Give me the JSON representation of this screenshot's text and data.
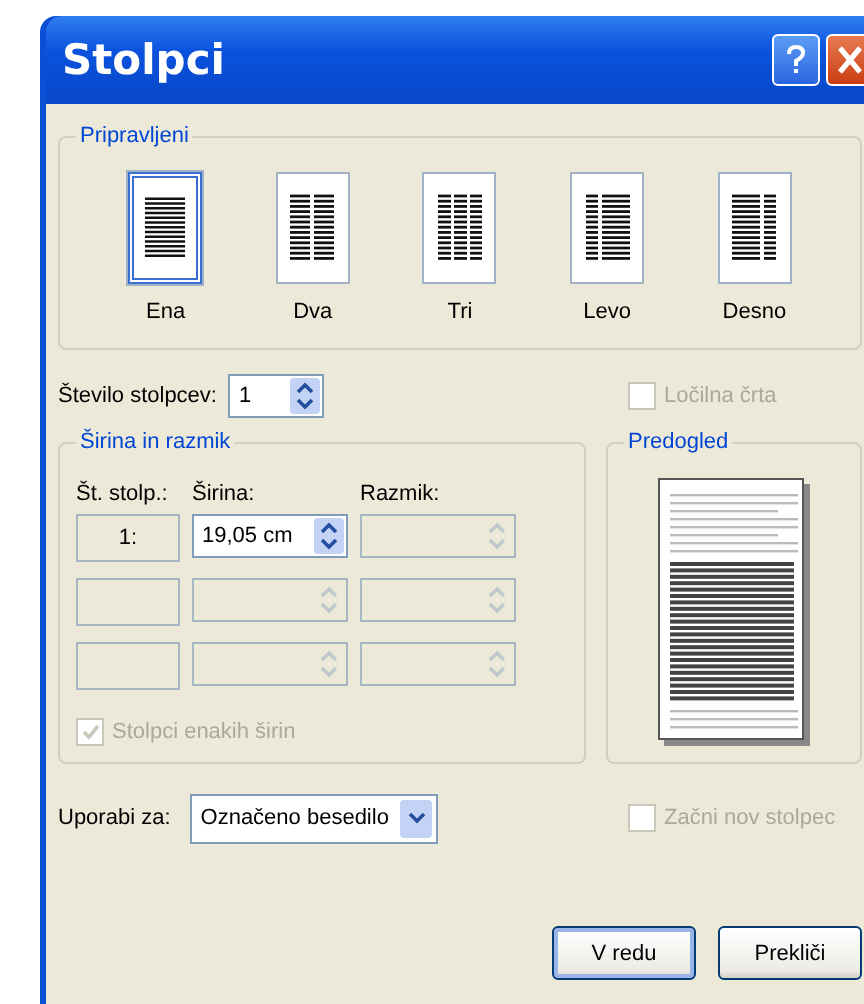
{
  "window": {
    "title": "Stolpci"
  },
  "presets": {
    "label": "Pripravljeni",
    "items": [
      {
        "label": "Ena",
        "kind": "one",
        "selected": true
      },
      {
        "label": "Dva",
        "kind": "two",
        "selected": false
      },
      {
        "label": "Tri",
        "kind": "three",
        "selected": false
      },
      {
        "label": "Levo",
        "kind": "left",
        "selected": false
      },
      {
        "label": "Desno",
        "kind": "right",
        "selected": false
      }
    ]
  },
  "number_of_columns": {
    "label": "Število stolpcev:",
    "value": "1"
  },
  "line_between": {
    "label": "Ločilna črta",
    "checked": false,
    "disabled": true
  },
  "width_spacing": {
    "label": "Širina in razmik",
    "columns": [
      "Št. stolp.:",
      "Širina:",
      "Razmik:"
    ],
    "rows": [
      {
        "number": "1:",
        "width": "19,05 cm",
        "disabled": false
      },
      {
        "disabled": true
      },
      {
        "disabled": true
      }
    ]
  },
  "equal_width": {
    "label": "Stolpci enakih širin",
    "checked": true,
    "disabled": true
  },
  "preview": {
    "label": "Predogled"
  },
  "apply_to": {
    "label": "Uporabi za:",
    "value": "Označeno besedilo"
  },
  "start_new_column": {
    "label": "Začni nov stolpec",
    "checked": false,
    "disabled": true
  },
  "buttons": [
    {
      "label": "V redu",
      "default": true
    },
    {
      "label": "Prekliči",
      "default": false
    }
  ]
}
